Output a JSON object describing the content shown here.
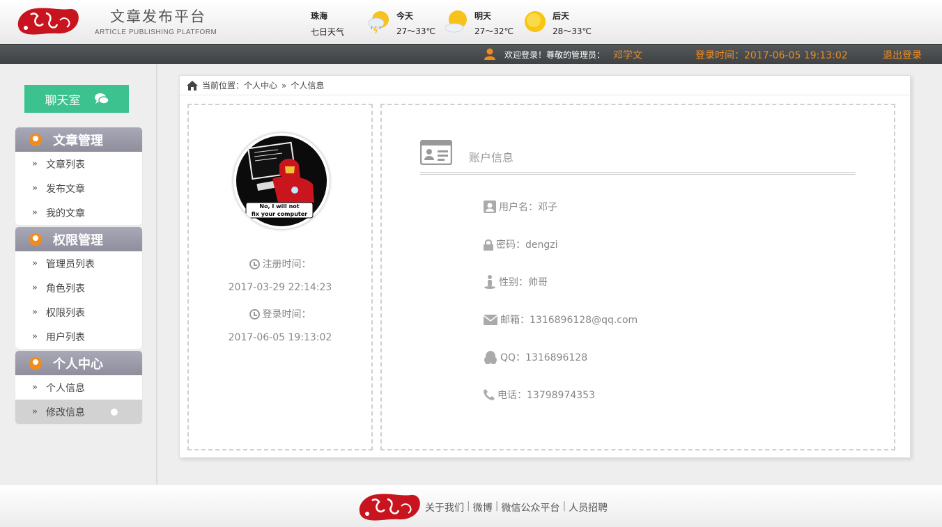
{
  "header": {
    "title": "文章发布平台",
    "subtitle": "ARTICLE PUBLISHING PLATFORM",
    "city": "珠海",
    "week_label": "七日天气",
    "forecast": [
      {
        "day": "今天",
        "temp": "27～33℃",
        "icon": "thunder-shower-icon"
      },
      {
        "day": "明天",
        "temp": "27～32℃",
        "icon": "partly-cloudy-icon"
      },
      {
        "day": "后天",
        "temp": "28～33℃",
        "icon": "sunny-icon"
      }
    ]
  },
  "topbar": {
    "welcome": "欢迎登录！尊敬的管理员：",
    "admin_name": "邓学文",
    "login_time": "登录时间：2017-06-05 19:13:02",
    "logout": "退出登录"
  },
  "sidebar": {
    "chat_label": "聊天室",
    "groups": [
      {
        "title": "文章管理",
        "items": [
          "文章列表",
          "发布文章",
          "我的文章"
        ]
      },
      {
        "title": "权限管理",
        "items": [
          "管理员列表",
          "角色列表",
          "权限列表",
          "用户列表"
        ]
      },
      {
        "title": "个人中心",
        "items": [
          "个人信息",
          "修改信息"
        ]
      }
    ],
    "active_item": "修改信息"
  },
  "breadcrumb": {
    "label": "当前位置：个人中心",
    "current": "个人信息"
  },
  "profile": {
    "avatar_caption": "No, I will not fix your computer",
    "reg_label": "注册时间：",
    "reg_time": "2017-03-29 22:14:23",
    "login_label": "登录时间：",
    "login_time": "2017-06-05 19:13:02"
  },
  "account": {
    "title": "账户信息",
    "username": "用户名：邓子",
    "password": "密码：dengzi",
    "gender": "性别：帅哥",
    "email": "邮箱：1316896128@qq.com",
    "qq": "QQ：1316896128",
    "phone": "电话：13798974353"
  },
  "footer": {
    "links": [
      "关于我们",
      "微博",
      "微信公众平台",
      "人员招聘"
    ]
  },
  "colors": {
    "accent_orange": "#f08c1e",
    "chat_green": "#3cc28f",
    "menu_head": "#9b9aa9",
    "logo_red": "#c8141e"
  }
}
